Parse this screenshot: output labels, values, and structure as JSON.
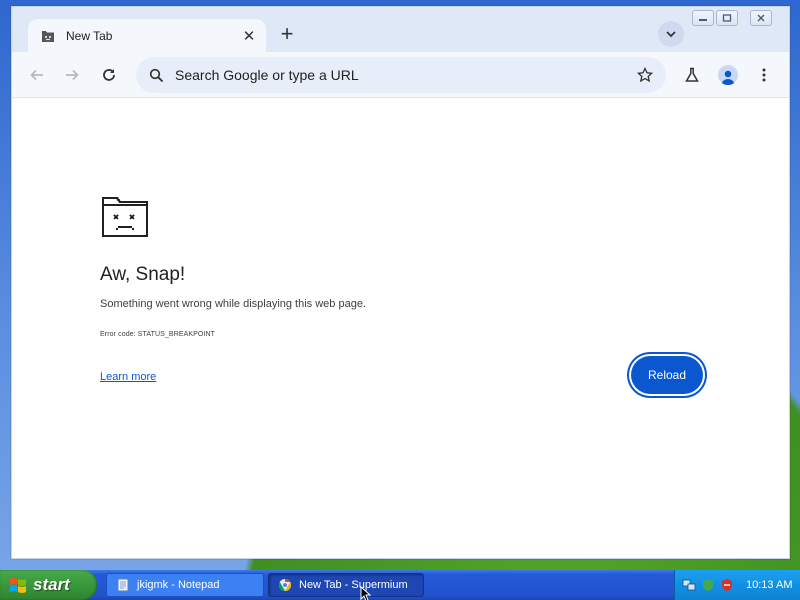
{
  "browser": {
    "tab": {
      "title": "New Tab",
      "close_symbol": "✕",
      "icon": "sad-folder-icon"
    },
    "new_tab_symbol": "+",
    "window_controls": [
      "minimize",
      "maximize",
      "close"
    ],
    "omnibox": {
      "placeholder": "Search Google or type a URL",
      "value": ""
    },
    "toolbar_icons": [
      "back-icon",
      "forward-icon",
      "reload-icon",
      "search-icon",
      "star-icon",
      "labs-icon",
      "profile-icon",
      "menu-icon"
    ]
  },
  "error_page": {
    "heading": "Aw, Snap!",
    "message": "Something went wrong while displaying this web page.",
    "error_code": "Error code: STATUS_BREAKPOINT",
    "learn_more": "Learn more",
    "reload_label": "Reload"
  },
  "taskbar": {
    "start_label": "start",
    "tasks": [
      {
        "label": "jkigmk - Notepad",
        "icon": "notepad-icon",
        "active": false
      },
      {
        "label": "New Tab - Supermium",
        "icon": "browser-icon",
        "active": true
      }
    ],
    "clock": "10:13 AM"
  },
  "colors": {
    "accent_blue": "#0b57d0",
    "titlebar": "#dfe8f7",
    "toolbar": "#f4f7fc",
    "taskbar": "#2253cf",
    "start_green": "#3a9a3c"
  }
}
